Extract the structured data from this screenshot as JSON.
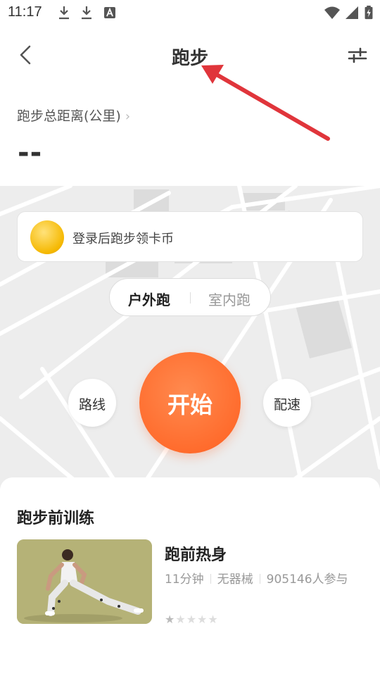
{
  "status_bar": {
    "time": "11:17"
  },
  "header": {
    "title": "跑步",
    "back_icon": "chevron-left-icon",
    "filter_icon": "sliders-icon"
  },
  "distance": {
    "label": "跑步总距离(公里)",
    "chevron": "›",
    "value": "--"
  },
  "coin_banner": {
    "text": "登录后跑步领卡币"
  },
  "mode_toggle": {
    "active": "户外跑",
    "inactive": "室内跑"
  },
  "controls": {
    "route_label": "路线",
    "start_label": "开始",
    "pace_label": "配速"
  },
  "training": {
    "section_title": "跑步前训练",
    "item": {
      "name": "跑前热身",
      "duration": "11分钟",
      "equipment": "无器械",
      "participants": "905146人参与",
      "rating_stars": 1,
      "rating_max": 5
    }
  },
  "colors": {
    "accent": "#ff6a2b",
    "arrow": "#e0353b",
    "coin": "#f5b800"
  }
}
